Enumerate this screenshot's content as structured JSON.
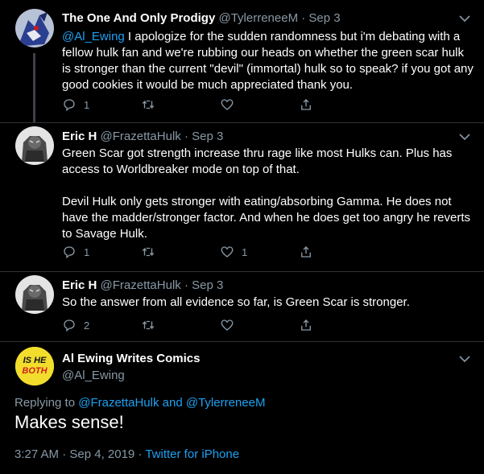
{
  "tweets": [
    {
      "name": "The One And Only Prodigy",
      "handle": "@TylerreneeM",
      "date": "Sep 3",
      "mention": "@Al_Ewing",
      "text": " I apologize for the sudden randomness but i'm debating with a fellow hulk fan and we're rubbing our heads on whether the green scar hulk is stronger than the current \"devil\" (immortal) hulk so to speak? if you got any good cookies it would be much appreciated thank you.",
      "replies": "1",
      "likes": ""
    },
    {
      "name": "Eric H",
      "handle": "@FrazettaHulk",
      "date": "Sep 3",
      "text_p1": "Green Scar got strength increase thru rage like most Hulks can. Plus has access to Worldbreaker mode on top of that.",
      "text_p2": "Devil Hulk only gets stronger with eating/absorbing Gamma. He does not have the madder/stronger factor. And when he does get too angry he reverts to Savage Hulk.",
      "replies": "1",
      "likes": "1"
    },
    {
      "name": "Eric H",
      "handle": "@FrazettaHulk",
      "date": "Sep 3",
      "text": "So the answer from all evidence so far, is Green Scar is stronger.",
      "replies": "2",
      "likes": ""
    }
  ],
  "main_tweet": {
    "name": "Al Ewing Writes Comics",
    "handle": "@Al_Ewing",
    "avatar_text": [
      "IS HE",
      "BOTH"
    ],
    "replying_label": "Replying to",
    "reply_to_1": "@FrazettaHulk",
    "and": " and ",
    "reply_to_2": "@TylerreneeM",
    "text": "Makes sense!",
    "time": "3:27 AM · Sep 4, 2019",
    "sep": " · ",
    "source": "Twitter for iPhone"
  },
  "colors": {
    "link": "#1da1f2",
    "muted": "#8899a6",
    "background": "#000000"
  },
  "icons": [
    "reply-icon",
    "retweet-icon",
    "like-icon",
    "share-icon",
    "chevron-down-icon"
  ]
}
